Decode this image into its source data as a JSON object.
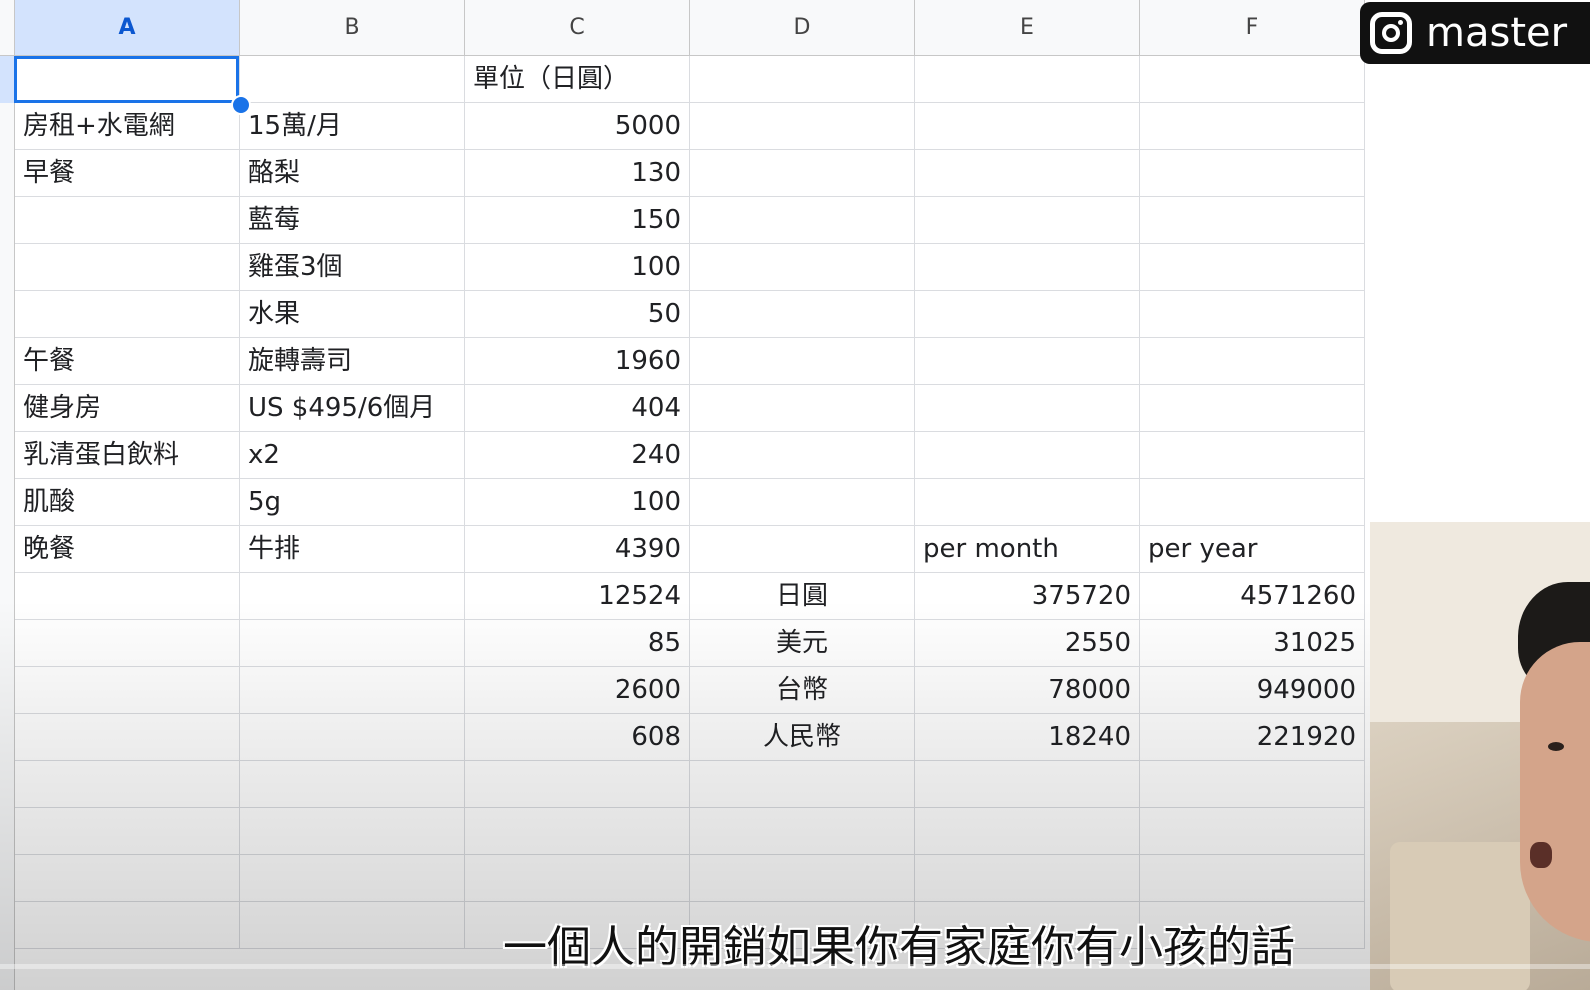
{
  "columns": [
    "A",
    "B",
    "C",
    "D",
    "E",
    "F"
  ],
  "active_column": "A",
  "rows": [
    [
      "",
      "",
      "單位（日圓）",
      "",
      "",
      ""
    ],
    [
      "房租+水電網",
      "15萬/月",
      "5000",
      "",
      "",
      ""
    ],
    [
      "早餐",
      "酪梨",
      "130",
      "",
      "",
      ""
    ],
    [
      "",
      "藍莓",
      "150",
      "",
      "",
      ""
    ],
    [
      "",
      "雞蛋3個",
      "100",
      "",
      "",
      ""
    ],
    [
      "",
      "水果",
      "50",
      "",
      "",
      ""
    ],
    [
      "午餐",
      "旋轉壽司",
      "1960",
      "",
      "",
      ""
    ],
    [
      "健身房",
      "US $495/6個月",
      "404",
      "",
      "",
      ""
    ],
    [
      "乳清蛋白飲料",
      "x2",
      "240",
      "",
      "",
      ""
    ],
    [
      "肌酸",
      "5g",
      "100",
      "",
      "",
      ""
    ],
    [
      "晚餐",
      "牛排",
      "4390",
      "",
      "per month",
      "per year"
    ],
    [
      "",
      "",
      "12524",
      "日圓",
      "375720",
      "4571260"
    ],
    [
      "",
      "",
      "85",
      "美元",
      "2550",
      "31025"
    ],
    [
      "",
      "",
      "2600",
      "台幣",
      "78000",
      "949000"
    ],
    [
      "",
      "",
      "608",
      "人民幣",
      "18240",
      "221920"
    ],
    [
      "",
      "",
      "",
      "",
      "",
      ""
    ],
    [
      "",
      "",
      "",
      "",
      "",
      ""
    ],
    [
      "",
      "",
      "",
      "",
      "",
      ""
    ],
    [
      "",
      "",
      "",
      "",
      "",
      ""
    ]
  ],
  "overlay": {
    "brand_text": "master",
    "brand_icon": "instagram-icon",
    "subtitle": "一個人的開銷如果你有家庭你有小孩的話",
    "video_progress": 0.0
  },
  "colors": {
    "accent": "#1a73e8",
    "header_active": "#d3e3fd",
    "progress": "#e3323b"
  }
}
